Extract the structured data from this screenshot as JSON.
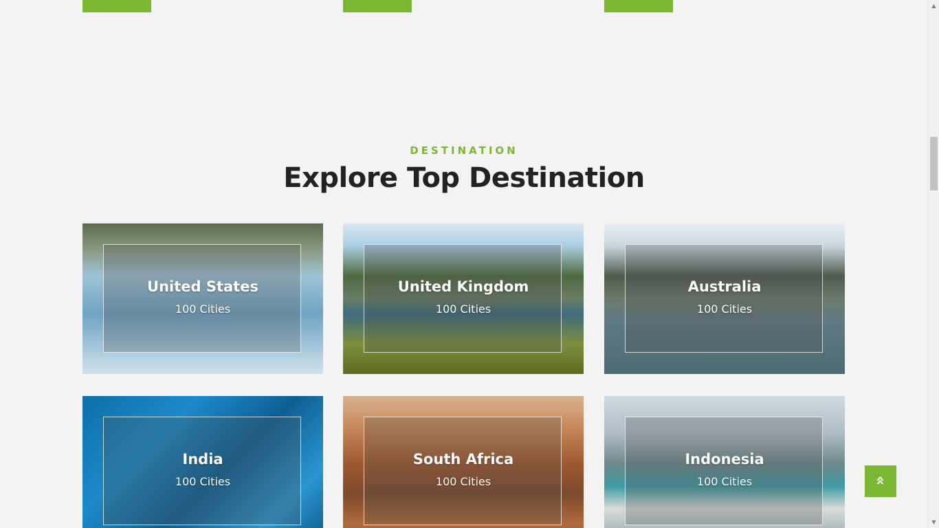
{
  "section": {
    "eyebrow": "DESTINATION",
    "title": "Explore Top Destination"
  },
  "destinations": [
    {
      "name": "United States",
      "count": "100 Cities"
    },
    {
      "name": "United Kingdom",
      "count": "100 Cities"
    },
    {
      "name": "Australia",
      "count": "100 Cities"
    },
    {
      "name": "India",
      "count": "100 Cities"
    },
    {
      "name": "South Africa",
      "count": "100 Cities"
    },
    {
      "name": "Indonesia",
      "count": "100 Cities"
    }
  ],
  "icons": {
    "back_to_top": "double-chevron-up-icon",
    "back_to_top_glyph": "»",
    "scroll_up": "▲",
    "scroll_down": "▼"
  },
  "colors": {
    "accent": "#7ab833",
    "title": "#222222",
    "background": "#f3f3f3"
  }
}
